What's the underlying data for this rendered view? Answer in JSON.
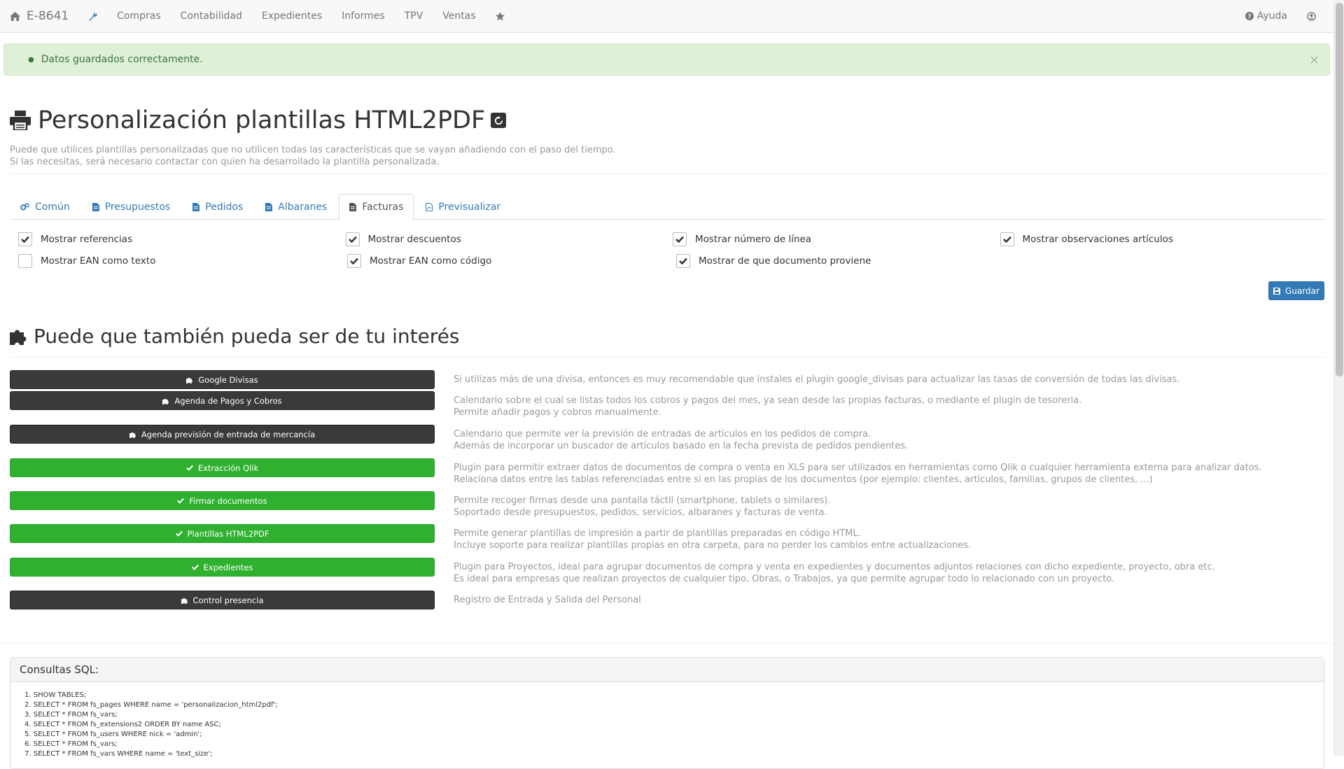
{
  "navbar": {
    "brand": "E-8641",
    "items": [
      "Compras",
      "Contabilidad",
      "Expedientes",
      "Informes",
      "TPV",
      "Ventas"
    ],
    "help": "Ayuda"
  },
  "alert": {
    "message": "Datos guardados correctamente.",
    "close": "×"
  },
  "header": {
    "title": "Personalización plantillas HTML2PDF",
    "desc_line1": "Puede que utilices plantillas personalizadas que no utilicen todas las características que se vayan añadiendo con el paso del tiempo.",
    "desc_line2": "Si las necesitas, será necesario contactar con quien ha desarrollado la plantilla personalizada."
  },
  "tabs": [
    {
      "label": "Común",
      "icon": "gears-icon"
    },
    {
      "label": "Presupuestos",
      "icon": "file-icon"
    },
    {
      "label": "Pedidos",
      "icon": "file-icon"
    },
    {
      "label": "Albaranes",
      "icon": "file-icon"
    },
    {
      "label": "Facturas",
      "icon": "file-icon",
      "active": true
    },
    {
      "label": "Previsualizar",
      "icon": "file-pdf-icon"
    }
  ],
  "options": [
    {
      "label": "Mostrar referencias",
      "checked": true
    },
    {
      "label": "Mostrar descuentos",
      "checked": true
    },
    {
      "label": "Mostrar número de línea",
      "checked": true
    },
    {
      "label": "Mostrar observaciones artículos",
      "checked": true
    },
    {
      "label": "Mostrar EAN como texto",
      "checked": false
    },
    {
      "label": "Mostrar EAN como código",
      "checked": true
    },
    {
      "label": "Mostrar de que documento proviene",
      "checked": true
    }
  ],
  "save_label": "Guardar",
  "plugins_title": "Puede que también pueda ser de tu interés",
  "plugins": [
    {
      "label": "Google Divisas",
      "installed": false,
      "desc1": "Si utilizas más de una divisa, entonces es muy recomendable que instales el plugin google_divisas para actualizar las tasas de conversión de todas las divisas.",
      "desc2": ""
    },
    {
      "label": "Agenda de Pagos y Cobros",
      "installed": false,
      "desc1": "Calendario sobre el cual se listas todos los cobros y pagos del mes, ya sean desde las propias facturas, o mediante el plugin de tesoreria.",
      "desc2": "Permite añadir pagos y cobros manualmente."
    },
    {
      "label": "Agenda previsión de entrada de mercancía",
      "installed": false,
      "desc1": "Calendario que permite ver la previsión de entradas de artículos en los pedidos de compra.",
      "desc2": "Además de incorporar un buscador de artículos basado en la fecha prevista de pedidos pendientes."
    },
    {
      "label": "Extracción Qlik",
      "installed": true,
      "desc1": "Plugin para permitir extraer datos de documentos de compra o venta en XLS para ser utilizados en herramientas como Qlik o cualquier herramienta externa para analizar datos.",
      "desc2": "Relaciona datos entre las tablas referenciadas entre si en las propias de los documentos (por ejemplo: clientes, artículos, familias, grupos de clientes, ...)"
    },
    {
      "label": "Firmar documentos",
      "installed": true,
      "desc1": "Permite recoger firmas desde una pantalla táctil (smartphone, tablets o similares).",
      "desc2": "Soportado desde presupuestos, pedidos, servicios, albaranes y facturas de venta."
    },
    {
      "label": "Plantillas HTML2PDF",
      "installed": true,
      "desc1": "Permite generar plantillas de impresión a partir de plantillas preparadas en código HTML.",
      "desc2": "Incluye soporte para realizar plantillas propias en otra carpeta, para no perder los cambios entre actualizaciones."
    },
    {
      "label": "Expedientes",
      "installed": true,
      "desc1": "Plugin para Proyectos, ideal para agrupar documentos de compra y venta en expedientes y documentos adjuntos relaciones con dicho expediente, proyecto, obra etc.",
      "desc2": "Es ideal para empresas que realizan proyectos de cualquier tipo, Obras, o Trabajos, ya que permite agrupar todo lo relacionado con un proyecto."
    },
    {
      "label": "Control presencia",
      "installed": false,
      "desc1": "Registro de Entrada y Salida del Personal",
      "desc2": ""
    }
  ],
  "sql": {
    "title": "Consultas SQL:",
    "queries": [
      "1. SHOW TABLES;",
      "2. SELECT * FROM fs_pages WHERE name = 'personalizacion_html2pdf';",
      "3. SELECT * FROM fs_vars;",
      "4. SELECT * FROM fs_extensions2 ORDER BY name ASC;",
      "5. SELECT * FROM fs_users WHERE nick = 'admin';",
      "6. SELECT * FROM fs_vars;",
      "7. SELECT * FROM fs_vars WHERE name = 'text_size';"
    ]
  }
}
